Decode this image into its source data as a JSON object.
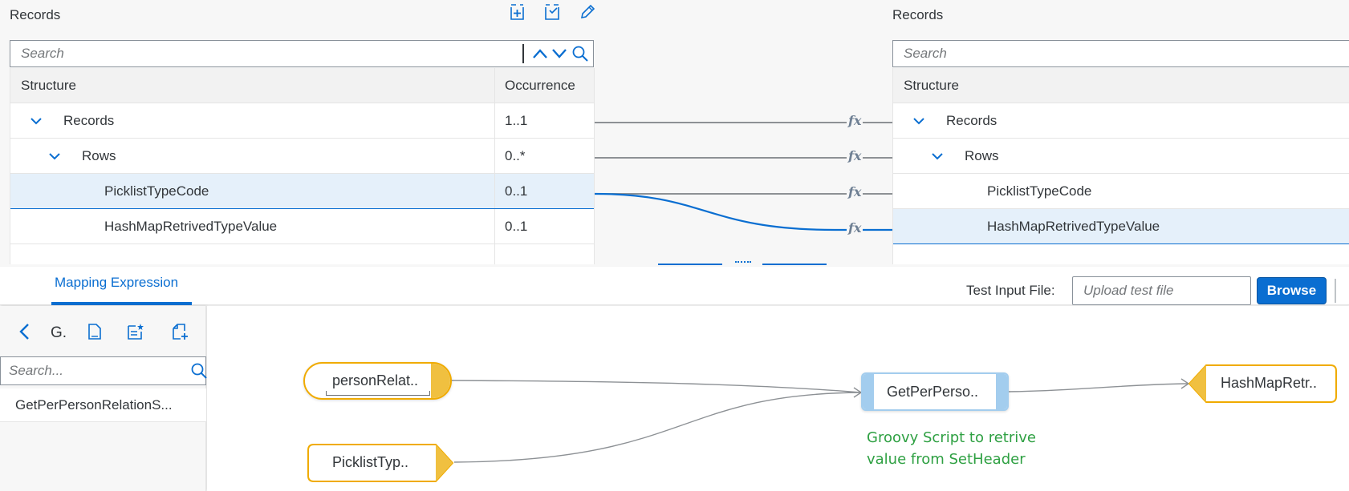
{
  "left_panel": {
    "title": "Records",
    "search_placeholder": "Search",
    "columns": {
      "structure": "Structure",
      "occurrence": "Occurrence"
    },
    "rows": [
      {
        "label": "Records",
        "occurrence": "1..1",
        "expanded": true,
        "selected": false
      },
      {
        "label": "Rows",
        "occurrence": "0..*",
        "expanded": true,
        "selected": false
      },
      {
        "label": "PicklistTypeCode",
        "occurrence": "0..1",
        "selected": true
      },
      {
        "label": "HashMapRetrivedTypeValue",
        "occurrence": "0..1",
        "selected": false
      }
    ]
  },
  "right_panel": {
    "title": "Records",
    "search_placeholder": "Search",
    "columns": {
      "structure": "Structure"
    },
    "rows": [
      {
        "label": "Records",
        "expanded": true,
        "selected": false
      },
      {
        "label": "Rows",
        "expanded": true,
        "selected": false
      },
      {
        "label": "PicklistTypeCode",
        "selected": false
      },
      {
        "label": "HashMapRetrivedTypeValue",
        "selected": true
      }
    ]
  },
  "toolbar": {
    "icons": [
      "add-element-icon",
      "remove-element-icon",
      "edit-icon"
    ]
  },
  "mapping_icon_glyph": "fx",
  "tabs": {
    "active_label": "Mapping Expression",
    "test_input_label": "Test Input File:",
    "upload_placeholder": "Upload test file",
    "browse_label": "Browse"
  },
  "functions_panel": {
    "back_icon": "chevron-left-icon",
    "label": "G.",
    "icons": [
      "document-icon",
      "new-document-icon",
      "add-document-icon"
    ],
    "search_placeholder": "Search...",
    "items": [
      "GetPerPersonRelationS..."
    ]
  },
  "canvas": {
    "sources": [
      {
        "label": "personRelat.."
      },
      {
        "label": "PicklistTyp.."
      }
    ],
    "function_node": {
      "label": "GetPerPerso.."
    },
    "target_node": {
      "label": "HashMapRetr.."
    },
    "note_lines": [
      "Groovy Script to retrive",
      "value from SetHeader"
    ]
  },
  "colors": {
    "brand_blue": "#0a6ed1",
    "source_yellow": "#f0ab00",
    "function_blue": "#a3cdee",
    "note_green": "#2ea042"
  }
}
